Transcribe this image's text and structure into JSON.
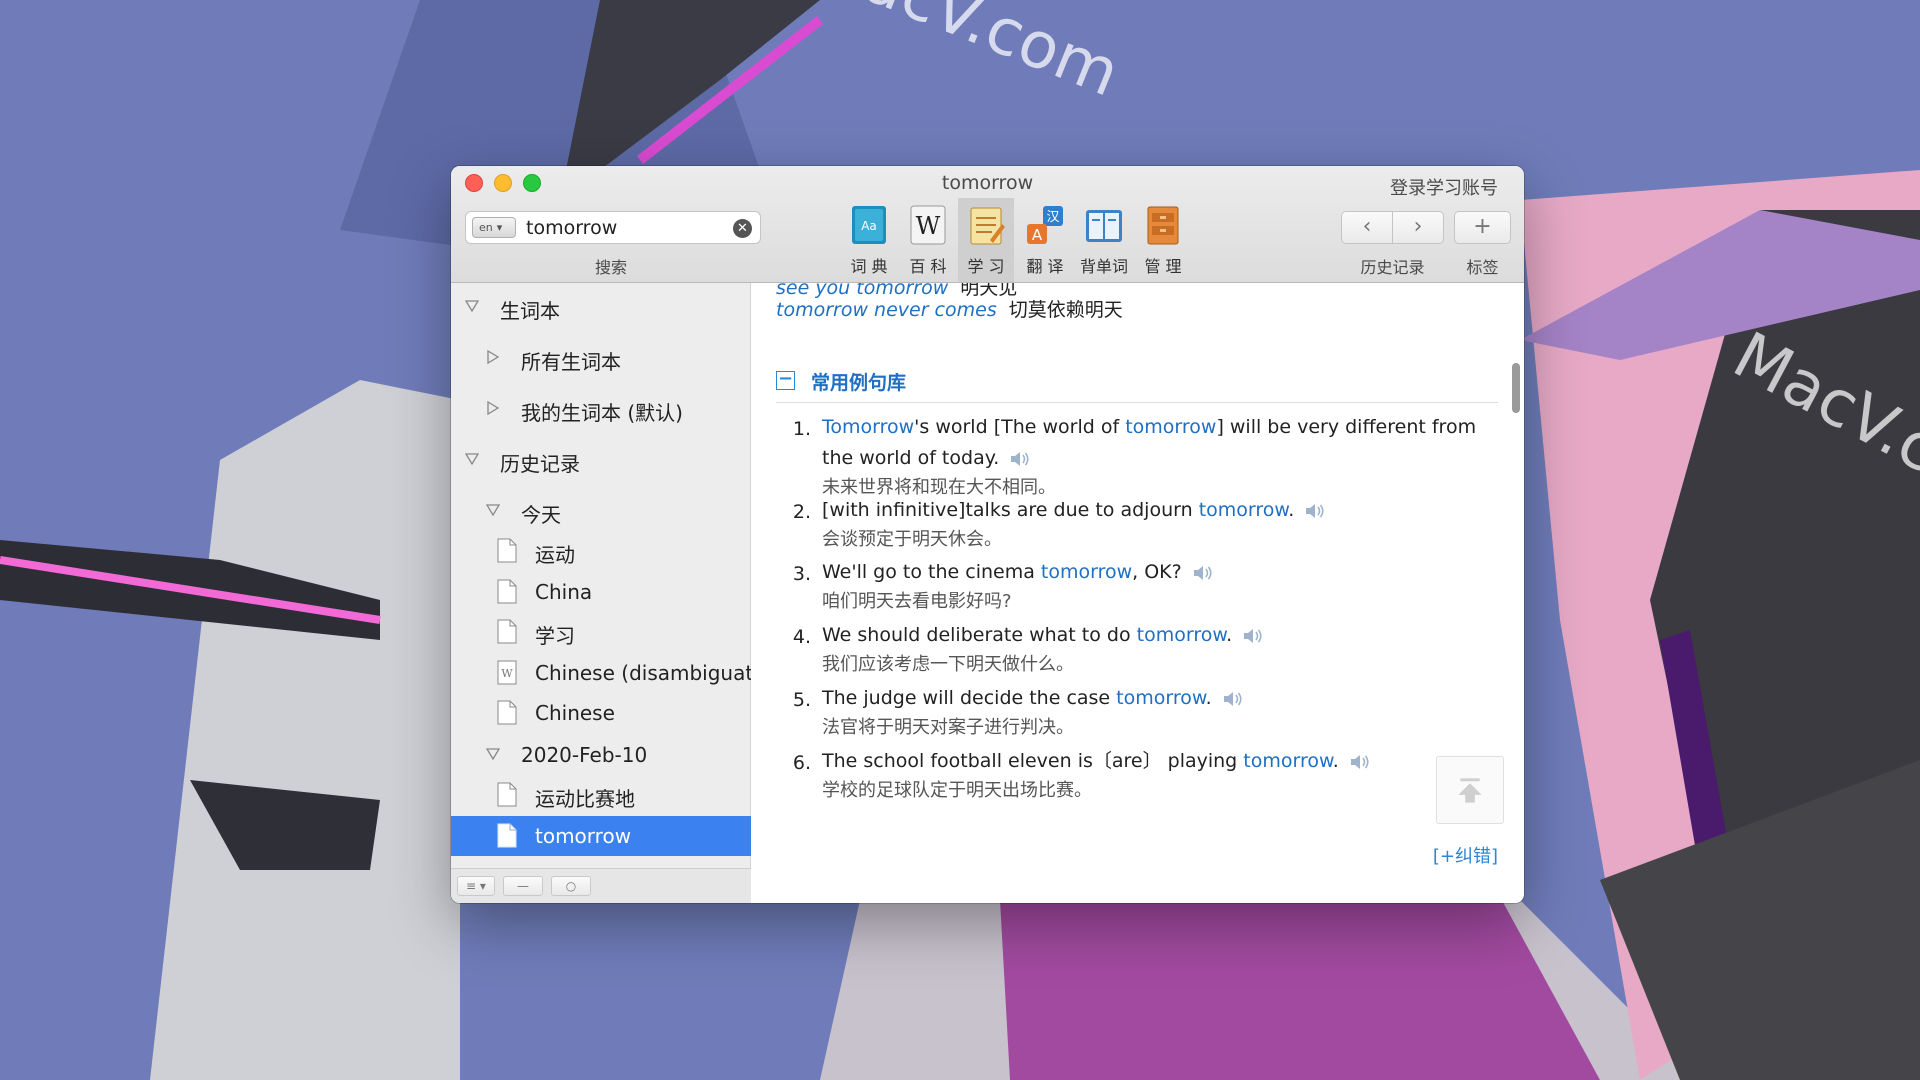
{
  "window": {
    "title": "tomorrow",
    "login_link": "登录学习账号"
  },
  "search": {
    "value": "tomorrow",
    "lang_badge": "en",
    "caption": "搜索"
  },
  "toolbar": {
    "tools": [
      {
        "label": "词 典",
        "icon": "dictionary-icon"
      },
      {
        "label": "百 科",
        "icon": "wikipedia-icon"
      },
      {
        "label": "学 习",
        "icon": "notebook-icon",
        "active": true
      },
      {
        "label": "翻 译",
        "icon": "translate-icon"
      },
      {
        "label": "背单词",
        "icon": "flashcards-icon"
      },
      {
        "label": "管 理",
        "icon": "manage-icon"
      }
    ],
    "history_caption": "历史记录",
    "tags_caption": "标签"
  },
  "sidebar": {
    "wordbook": "生词本",
    "all_wordbooks": "所有生词本",
    "my_wordbook": "我的生词本 (默认)",
    "history": "历史记录",
    "today": "今天",
    "today_items": [
      "运动",
      "China",
      "学习",
      "Chinese (disambiguation)",
      "Chinese"
    ],
    "date_group": "2020-Feb-10",
    "date_items": [
      "运动比赛地",
      "tomorrow"
    ]
  },
  "content": {
    "phrases": [
      {
        "en": "see you tomorrow",
        "cn": "明天见"
      },
      {
        "en": "tomorrow never comes",
        "cn": "切莫依赖明天"
      }
    ],
    "section_title": "常用例句库",
    "correct_link": "[+纠错]",
    "examples": [
      {
        "num": "1.",
        "parts": [
          {
            "t": "Tomorrow",
            "k": true
          },
          {
            "t": "'s world [The world of "
          },
          {
            "t": "tomorrow",
            "k": true
          },
          {
            "t": "] will be very different from the world of today."
          }
        ],
        "cn": "未来世界将和现在大不相同。"
      },
      {
        "num": "2.",
        "parts": [
          {
            "t": "[with infinitive]talks are due to adjourn "
          },
          {
            "t": "tomorrow",
            "k": true
          },
          {
            "t": "."
          }
        ],
        "cn": "会谈预定于明天休会。"
      },
      {
        "num": "3.",
        "parts": [
          {
            "t": "We'll go to the cinema "
          },
          {
            "t": "tomorrow",
            "k": true
          },
          {
            "t": ", OK?"
          }
        ],
        "cn": "咱们明天去看电影好吗?"
      },
      {
        "num": "4.",
        "parts": [
          {
            "t": "We should deliberate what to do "
          },
          {
            "t": "tomorrow",
            "k": true
          },
          {
            "t": "."
          }
        ],
        "cn": "我们应该考虑一下明天做什么。"
      },
      {
        "num": "5.",
        "parts": [
          {
            "t": "The judge will decide the case "
          },
          {
            "t": "tomorrow",
            "k": true
          },
          {
            "t": "."
          }
        ],
        "cn": "法官将于明天对案子进行判决。"
      },
      {
        "num": "6.",
        "parts": [
          {
            "t": "The school football eleven is〔are〕 playing "
          },
          {
            "t": "tomorrow",
            "k": true
          },
          {
            "t": "."
          }
        ],
        "cn": "学校的足球队定于明天出场比赛。"
      }
    ]
  },
  "watermark": "MacV.com",
  "colors": {
    "accent": "#1f6fc4",
    "selection": "#3b82f0",
    "desktop": "#6e7bb8"
  }
}
